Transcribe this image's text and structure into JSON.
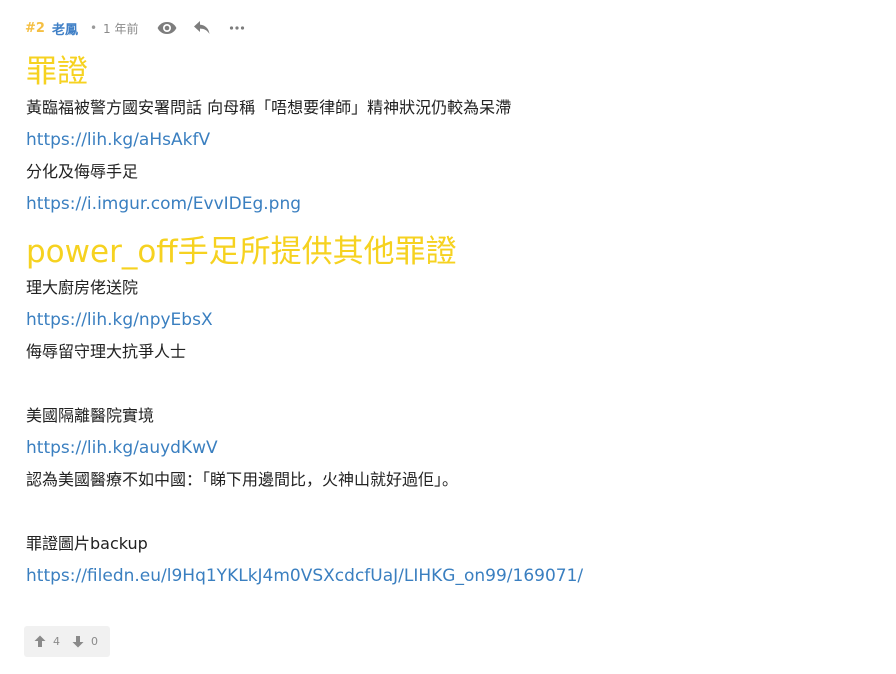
{
  "header": {
    "floor": "#2",
    "username": "老鳳",
    "separator": "•",
    "time": "1 年前",
    "icons": [
      "eye-icon",
      "reply-icon",
      "more-icon"
    ]
  },
  "post": {
    "heading1": "罪證",
    "lines1": [
      "黃臨福被警方國安署問話 向母稱「唔想要律師」精神狀況仍較為呆滯"
    ],
    "link1": "https://lih.kg/aHsAkfV",
    "text2": "分化及侮辱手足",
    "link2": "https://i.imgur.com/EvvIDEg.png",
    "heading2": "power_off手足所提供其他罪證",
    "text3": "理大廚房佬送院",
    "link3": "https://lih.kg/npyEbsX",
    "text4": "侮辱留守理大抗爭人士",
    "text5": "美國隔離醫院實境",
    "link4": "https://lih.kg/auydKwV",
    "text6": "認為美國醫療不如中國：「睇下用邊間比，火神山就好過佢」。",
    "text7": "罪證圖片backup",
    "link5": "https://filedn.eu/l9Hq1YKLkJ4m0VSXcdcfUaJ/LIHKG_on99/169071/"
  },
  "votes": {
    "up": "4",
    "down": "0"
  },
  "colors": {
    "floor": "#f5bf42",
    "username": "#3f7fc6",
    "heading": "#f6d220",
    "link": "#3a7fc0",
    "vote_bg": "#f1f1f1"
  }
}
